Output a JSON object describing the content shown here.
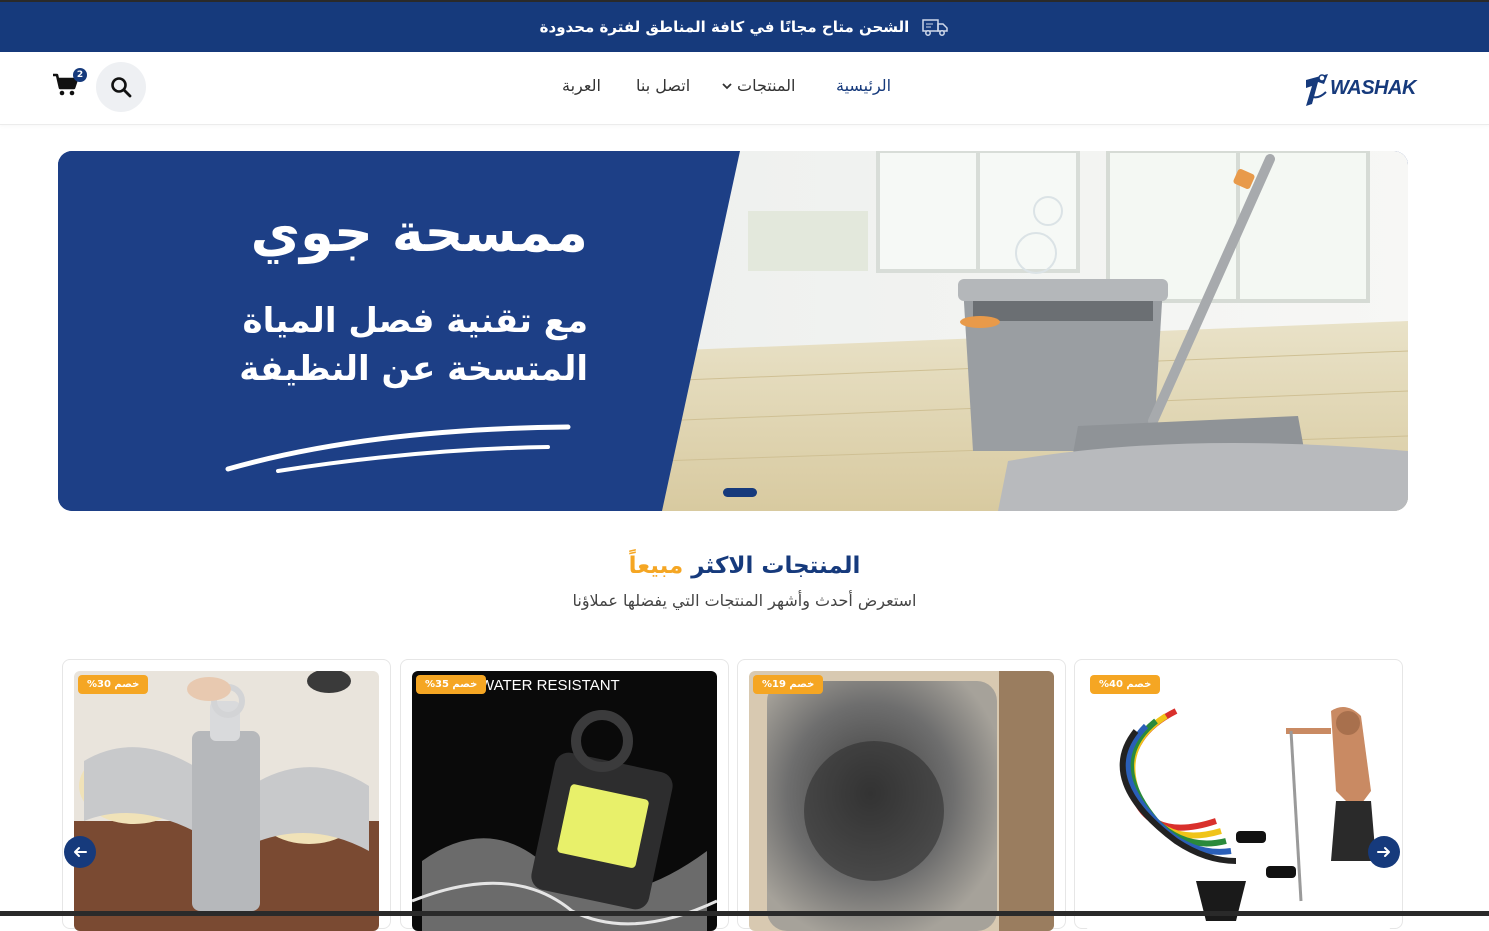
{
  "announcement": {
    "text": "الشحن متاح مجانًا في كافة المناطق لفترة محدودة",
    "icon": "truck-icon"
  },
  "header": {
    "logo_text": "WASHAK",
    "nav": {
      "home": "الرئيسية",
      "products": "المنتجات",
      "contact": "اتصل بنا",
      "cart": "العربة"
    },
    "cart_count": "2",
    "icons": [
      "search-icon",
      "cart-icon",
      "chevron-down-icon"
    ]
  },
  "hero": {
    "title": "ممسحة جوي",
    "line1": "مع تقنية فصل المياة",
    "line2": "المتسخة عن النظيفة",
    "active_slide": 1
  },
  "bestsellers": {
    "title_main": "المنتجات الاكثر",
    "title_accent": "مبيعاً",
    "subtitle": "استعرض أحدث وأشهر المنتجات التي يفضلها عملاؤنا"
  },
  "products": [
    {
      "badge": "خصم 30%"
    },
    {
      "badge": "خصم 35%",
      "image_text": "WATER RESISTANT"
    },
    {
      "badge": "خصم 19%"
    },
    {
      "badge": "خصم 40%"
    }
  ],
  "colors": {
    "primary": "#163a7c",
    "accent": "#f5a623"
  }
}
